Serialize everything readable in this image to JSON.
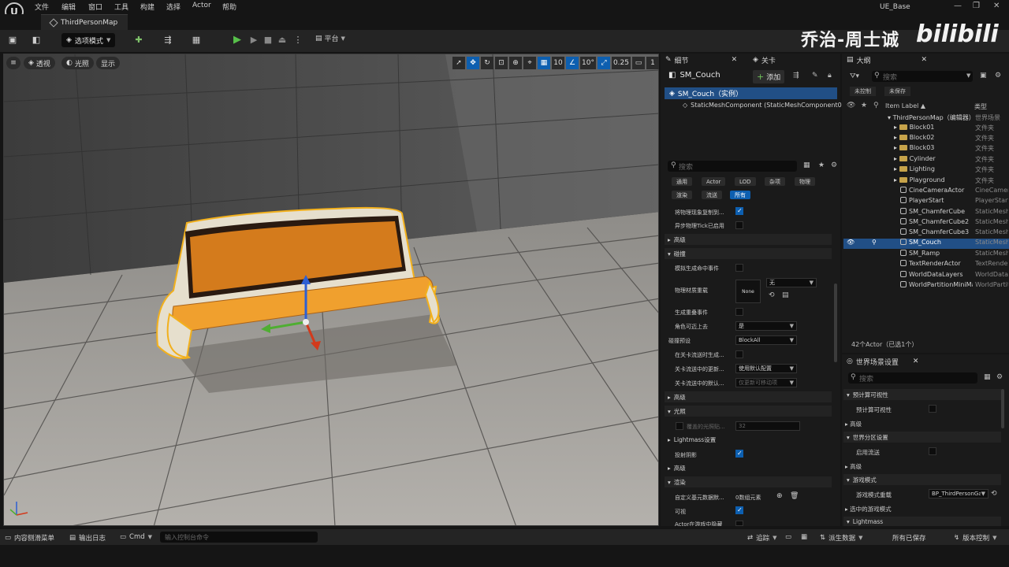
{
  "menubar": {
    "logo": "U",
    "items": [
      "文件",
      "编辑",
      "窗口",
      "工具",
      "构建",
      "选择",
      "Actor",
      "帮助"
    ],
    "app_title": "UE_Base",
    "win_min": "—",
    "win_max": "❐",
    "win_close": "✕"
  },
  "tab": {
    "title": "ThirdPersonMap"
  },
  "toolbar": {
    "mode_label": "选项模式",
    "platform_label": "平台"
  },
  "watermark": {
    "author": "乔治-周士诚",
    "brand": "bilibili"
  },
  "viewport": {
    "menu_icon": "≡",
    "perspective": "透视",
    "lighting": "光照",
    "show": "显示",
    "grid_snap": "10",
    "rot_snap": "10°",
    "scale_snap": "0.25",
    "cam_speed": "1",
    "colors": {
      "wall": "#5a5a5a",
      "floor": "#b8b6b2",
      "seat": "#f0a02e",
      "frame": "#e3dcc8",
      "outline": "#f2b01c"
    }
  },
  "details": {
    "tab_label": "细节",
    "tab2_label": "关卡",
    "actor_name": "SM_Couch",
    "add_label": "添加",
    "comp_root": "SM_Couch（实例）",
    "comp_child": "StaticMeshComponent (StaticMeshComponent0",
    "search_placeholder": "搜索",
    "filters_row1": [
      "通用",
      "Actor",
      "LOD",
      "杂项",
      "物理"
    ],
    "filters_row2": [
      "渲染",
      "流送",
      "所有"
    ],
    "props": {
      "p1": "将物理现象复制到...",
      "p2": "异步物理Tick已启用",
      "sec_advanced1": "高级",
      "sec_collision": "碰撞",
      "p3": "模拟生成命中事件",
      "p4": "物理材质重载",
      "mat_none": "None",
      "mat_value": "无",
      "p5": "生成重叠事件",
      "p6": "角色可迈上去",
      "p6_val": "是",
      "p7": "碰撞预设",
      "p7_val": "BlockAll",
      "p8": "在关卡流送时生成...",
      "p9": "关卡流送中的更新...",
      "p9_val": "使用默认配置",
      "p10": "关卡流送中的默认...",
      "p10_val": "仅更新可移动项",
      "sec_advanced2": "高级",
      "sec_light": "光照",
      "p11": "覆盖的光照贴...",
      "p11_val": "32",
      "sec_lightmass": "Lightmass设置",
      "p12": "投射阴影",
      "sec_advanced3": "高级",
      "sec_render": "渲染",
      "p13": "自定义基元数据默...",
      "p13_val": "0数组元素",
      "p14": "可视",
      "p15": "Actor在游戏中隐藏"
    }
  },
  "outliner": {
    "tab_label": "大纲",
    "search_placeholder": "搜索",
    "btn_uncontrolled": "未控制",
    "btn_unsaved": "未保存",
    "col_label": "Item Label ▲",
    "col_type": "类型",
    "rows": [
      {
        "label": "ThirdPersonMap（编辑器）",
        "type": "世界场景",
        "kind": "root"
      },
      {
        "label": "Block01",
        "type": "文件夹",
        "kind": "folder"
      },
      {
        "label": "Block02",
        "type": "文件夹",
        "kind": "folder"
      },
      {
        "label": "Block03",
        "type": "文件夹",
        "kind": "folder"
      },
      {
        "label": "Cylinder",
        "type": "文件夹",
        "kind": "folder"
      },
      {
        "label": "Lighting",
        "type": "文件夹",
        "kind": "folder"
      },
      {
        "label": "Playground",
        "type": "文件夹",
        "kind": "folder"
      },
      {
        "label": "CineCameraActor",
        "type": "CineCameraActor",
        "kind": "actor"
      },
      {
        "label": "PlayerStart",
        "type": "PlayerStart",
        "kind": "actor"
      },
      {
        "label": "SM_ChamferCube",
        "type": "StaticMeshActor",
        "kind": "actor"
      },
      {
        "label": "SM_ChamferCube2",
        "type": "StaticMeshActor",
        "kind": "actor"
      },
      {
        "label": "SM_ChamferCube3",
        "type": "StaticMeshActor",
        "kind": "actor"
      },
      {
        "label": "SM_Couch",
        "type": "StaticMeshActor",
        "kind": "actor",
        "selected": true
      },
      {
        "label": "SM_Ramp",
        "type": "StaticMeshActor",
        "kind": "actor"
      },
      {
        "label": "TextRenderActor",
        "type": "TextRenderActor",
        "kind": "actor"
      },
      {
        "label": "WorldDataLayers",
        "type": "WorldDataLayers",
        "kind": "actor"
      },
      {
        "label": "WorldPartitionMiniMap",
        "type": "WorldPartitionMiniMap",
        "kind": "actor"
      }
    ],
    "count": "42个Actor（已选1个）"
  },
  "world": {
    "tab_label": "世界场景设置",
    "search_placeholder": "搜索",
    "sec1": "预计算可视性",
    "r1": "预计算可视性",
    "r1_adv": "高级",
    "sec2": "世界分区设置",
    "r2": "启用流送",
    "r2_adv": "高级",
    "sec3": "游戏模式",
    "r3": "游戏模式重载",
    "r3_val": "BP_ThirdPersonGameMode",
    "r4": "选中的游戏模式",
    "sec4": "Lightmass"
  },
  "status": {
    "drawer": "内容侧滑菜单",
    "output": "输出日志",
    "cmd": "Cmd",
    "cmd_placeholder": "输入控制台命令",
    "trace": "追踪",
    "derived": "派生数据",
    "saved": "所有已保存",
    "vcs": "版本控制"
  }
}
